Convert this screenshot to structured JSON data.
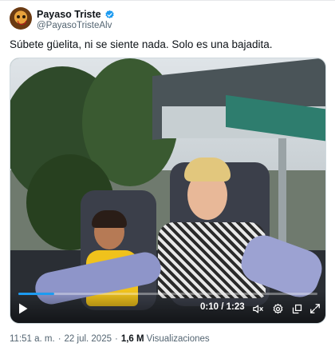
{
  "author": {
    "display_name": "Payaso Triste",
    "handle": "@PayasoTristeAlv",
    "verified": true
  },
  "tweet": {
    "text": "Súbete güelita, ni se siente nada. Solo es una bajadita."
  },
  "video": {
    "current_time": "0:10",
    "duration": "1:23",
    "time_display": "0:10 / 1:23",
    "progress_fraction": 0.12
  },
  "meta": {
    "time": "11:51 a. m.",
    "date": "22 jul. 2025",
    "views_count": "1,6 M",
    "views_label": "Visualizaciones",
    "separator": "·"
  },
  "colors": {
    "accent": "#1d9bf0",
    "text_primary": "#0f1419",
    "text_secondary": "#536471"
  },
  "icons": {
    "play": "play-icon",
    "volume": "volume-muted-icon",
    "settings": "gear-icon",
    "popout": "popout-icon",
    "fullscreen": "fullscreen-icon",
    "verified": "verified-badge-icon"
  }
}
